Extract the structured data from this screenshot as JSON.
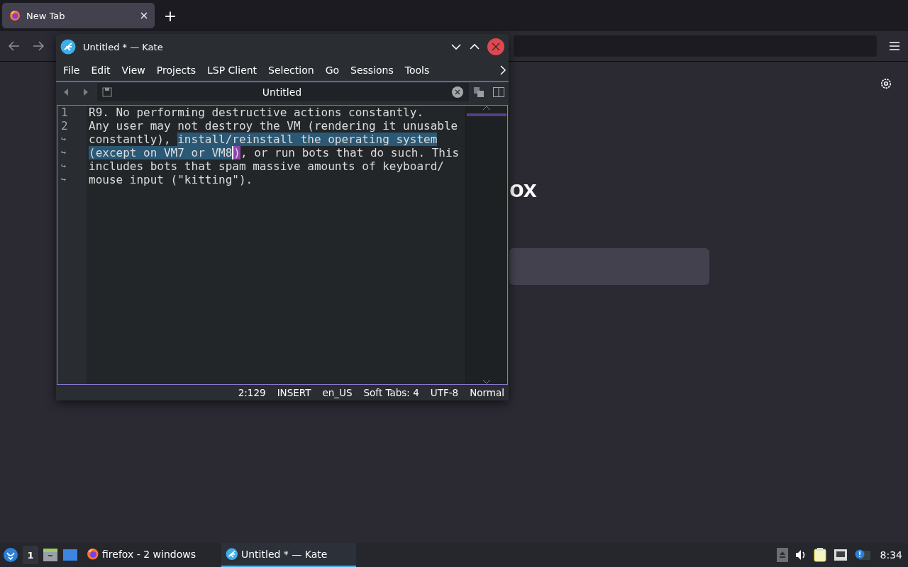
{
  "browser": {
    "tabs": [
      {
        "title": "New Tab",
        "selected": true
      }
    ],
    "new_tab": "+",
    "logo_text": "ox"
  },
  "editor_window": {
    "title": "Untitled * — Kate",
    "menu": [
      "File",
      "Edit",
      "View",
      "Projects",
      "LSP Client",
      "Selection",
      "Go",
      "Sessions",
      "Tools"
    ],
    "document_tab": {
      "title": "Untitled"
    },
    "rows": [
      {
        "gutter": "1",
        "segments": [
          {
            "text": "R9. No performing destructive actions constantly.",
            "kind": "plain"
          }
        ]
      },
      {
        "gutter": "2",
        "segments": [
          {
            "text": "Any user may not destroy the VM (rendering it unusable",
            "kind": "plain"
          }
        ]
      },
      {
        "gutter": "↪",
        "segments": [
          {
            "text": "constantly), ",
            "kind": "plain"
          },
          {
            "text": "install/reinstall the operating system",
            "kind": "selection"
          }
        ]
      },
      {
        "gutter": "↪",
        "segments": [
          {
            "text": "(except on VM7 or VM8",
            "kind": "selection"
          },
          {
            "text": ")",
            "kind": "bracket"
          },
          {
            "text": ", or run bots that do such. This",
            "kind": "plain"
          }
        ]
      },
      {
        "gutter": "↪",
        "segments": [
          {
            "text": "includes bots that spam massive amounts of keyboard/",
            "kind": "plain"
          }
        ]
      },
      {
        "gutter": "↪",
        "segments": [
          {
            "text": "mouse input (\"kitting\").",
            "kind": "plain"
          }
        ]
      }
    ],
    "status_bar": [
      "2:129",
      "INSERT",
      "en_US",
      "Soft Tabs: 4",
      "UTF-8",
      "Normal"
    ]
  },
  "taskbar": {
    "pager": "1",
    "tasks": [
      {
        "title": "firefox - 2 windows",
        "kind": "firefox",
        "selected": false
      },
      {
        "title": "Untitled * — Kate",
        "kind": "kate",
        "selected": true
      }
    ],
    "clock": "8:34"
  }
}
